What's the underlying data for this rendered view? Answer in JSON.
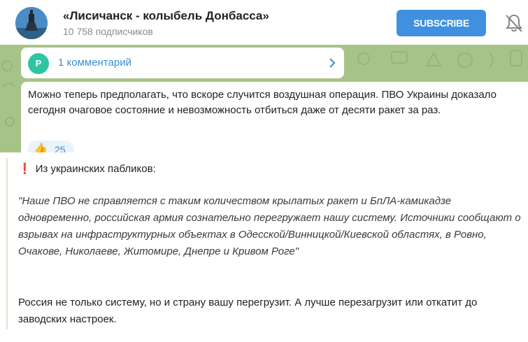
{
  "header": {
    "title": "«Лисичанск - колыбель Донбасса»",
    "subscribers": "10 758 подписчиков",
    "subscribe_label": "SUBSCRIBE",
    "bell_icon": "bell-muted-icon"
  },
  "comments": {
    "avatar_letter": "P",
    "label": "1 комментарий",
    "chevron_icon": "chevron-right-icon"
  },
  "message": {
    "text": "Можно теперь предполагать, что вскоре случится воздушная операция. ПВО Украины доказало сегодня очаговое состояние и невозможность отбиться даже от десяти ракет за раз.",
    "reaction_emoji": "👍",
    "reaction_count": "25"
  },
  "post": {
    "heading_mark": "❗",
    "heading": "Из украинских пабликов:",
    "quote": "\"Наше ПВО не справляется с таким количеством крылатых ракет и БпЛА-камикадзе одновременно, российская армия сознательно перегружает нашу систему. Источники сообщают о взрывах на инфраструктурных объектах в Одесской/Винницкой/Киевской областях, в Ровно, Очакове, Николаеве, Житомире, Днепре и Кривом Роге\"",
    "body": "Россия не только систему, но и страну вашу перегрузит. А лучше перезагрузит или откатит до заводских настроек."
  },
  "colors": {
    "subscribe_button": "#3f91df",
    "chat_background": "#a7c488",
    "link": "#3a8fd0",
    "comment_avatar": "#2fc5a2"
  }
}
